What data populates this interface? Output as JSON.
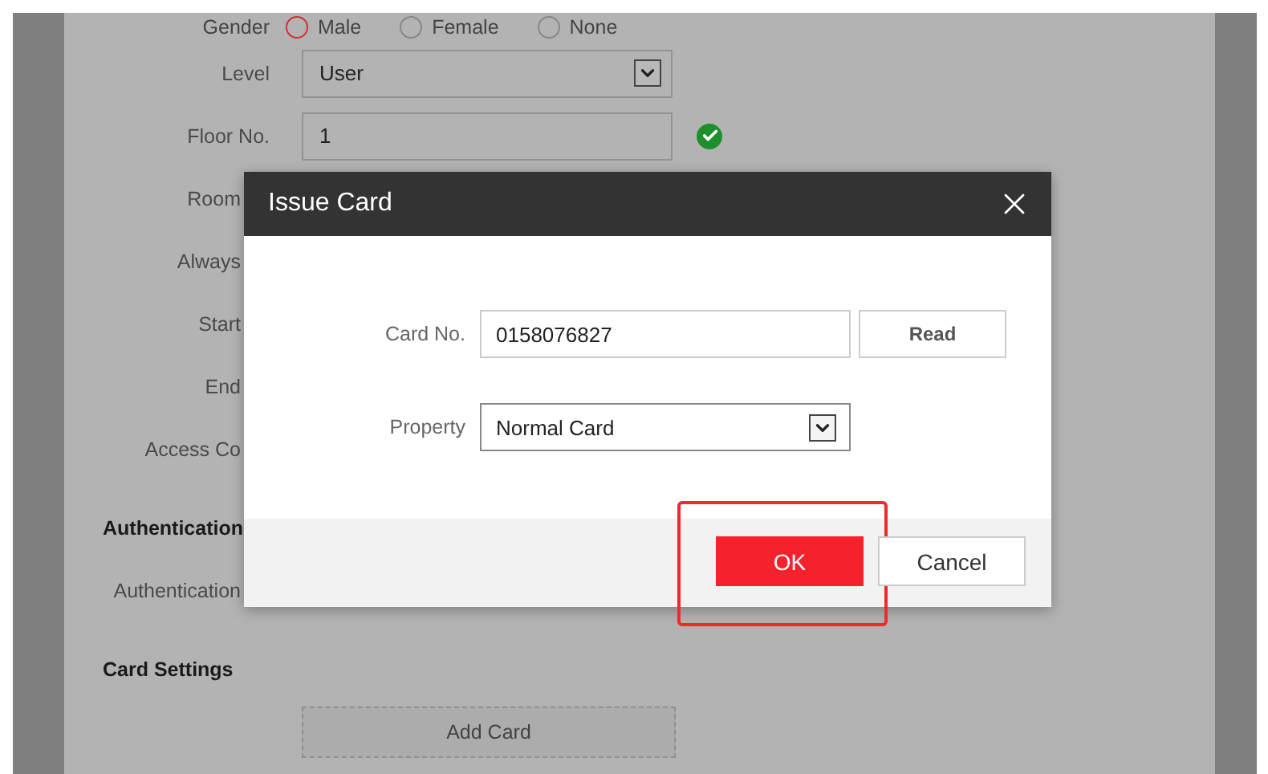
{
  "page": {
    "gender": {
      "label": "Gender",
      "options": [
        {
          "label": "Male",
          "selected": true
        },
        {
          "label": "Female",
          "selected": false
        },
        {
          "label": "None",
          "selected": false
        }
      ]
    },
    "rows": [
      {
        "kind": "select",
        "label": "Level",
        "value": "User",
        "covered": false
      },
      {
        "kind": "input",
        "label": "Floor No.",
        "value": "1",
        "valid": true,
        "covered": false
      },
      {
        "kind": "label",
        "label": "Room",
        "covered": true
      },
      {
        "kind": "label",
        "label": "Always",
        "covered": true
      },
      {
        "kind": "label",
        "label": "Start",
        "covered": true
      },
      {
        "kind": "label",
        "label": "End",
        "covered": true
      },
      {
        "kind": "label",
        "label": "Access Co",
        "covered": true
      },
      {
        "kind": "heading",
        "label": "Authentication"
      },
      {
        "kind": "label",
        "label": "Authentication",
        "covered": true
      },
      {
        "kind": "heading",
        "label": "Card Settings"
      },
      {
        "kind": "button",
        "label": "Add Card"
      }
    ]
  },
  "dialog": {
    "title": "Issue Card",
    "fields": [
      {
        "kind": "input",
        "label": "Card No.",
        "value": "0158076827",
        "button": "Read"
      },
      {
        "kind": "select",
        "label": "Property",
        "value": "Normal Card"
      }
    ],
    "buttons": [
      {
        "kind": "primary",
        "label": "OK",
        "highlighted": true
      },
      {
        "kind": "secondary",
        "label": "Cancel",
        "highlighted": false
      }
    ]
  }
}
